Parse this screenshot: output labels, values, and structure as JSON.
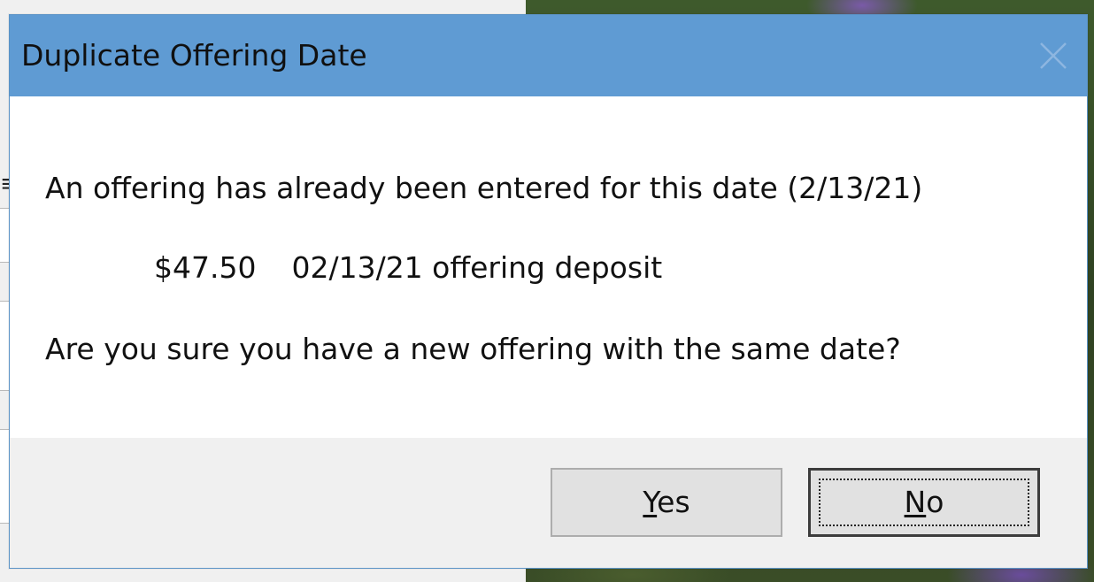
{
  "dialog": {
    "title": "Duplicate Offering Date",
    "message_line1": "An offering has already been entered for this date (2/13/21)",
    "detail": {
      "amount": "$47.50",
      "description": "02/13/21 offering deposit"
    },
    "message_line3": "Are you sure you have a new offering with the same date?",
    "buttons": {
      "yes": {
        "mnemonic": "Y",
        "rest": "es"
      },
      "no": {
        "mnemonic": "N",
        "rest": "o"
      }
    },
    "default_button": "No",
    "close_icon": "close-icon"
  },
  "colors": {
    "titlebar": "#5f9bd3",
    "dialog_border": "#5b93c6",
    "footer": "#f0f0f0",
    "button_face": "#e1e1e1"
  }
}
